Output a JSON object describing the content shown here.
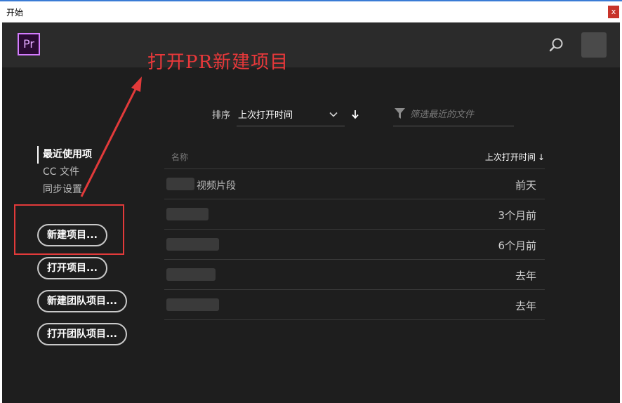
{
  "window": {
    "title": "开始",
    "close_label": "x"
  },
  "header": {
    "logo_text": "Pr",
    "search_icon": "search-icon",
    "avatar": "avatar"
  },
  "annotation": {
    "text": "打开PR新建项目",
    "color": "#e8383a"
  },
  "nav": {
    "items": [
      {
        "label": "最近使用项",
        "active": true
      },
      {
        "label": "CC 文件",
        "active": false
      },
      {
        "label": "同步设置",
        "active": false
      }
    ]
  },
  "actions": {
    "new_project": "新建项目...",
    "open_project": "打开项目...",
    "new_team_project": "新建团队项目...",
    "open_team_project": "打开团队项目..."
  },
  "sort": {
    "label": "排序",
    "value": "上次打开时间"
  },
  "filter": {
    "placeholder": "筛选最近的文件"
  },
  "table": {
    "columns": {
      "name": "名称",
      "date": "上次打开时间"
    },
    "rows": [
      {
        "name": "视频片段",
        "date": "前天"
      },
      {
        "name": "",
        "date": "3个月前"
      },
      {
        "name": "",
        "date": "6个月前"
      },
      {
        "name": "",
        "date": "去年"
      },
      {
        "name": "",
        "date": "去年"
      }
    ]
  },
  "colors": {
    "accent_pr": "#d47cff",
    "highlight": "#e23a3a",
    "background": "#1e1e1e",
    "header": "#2b2b2b"
  }
}
